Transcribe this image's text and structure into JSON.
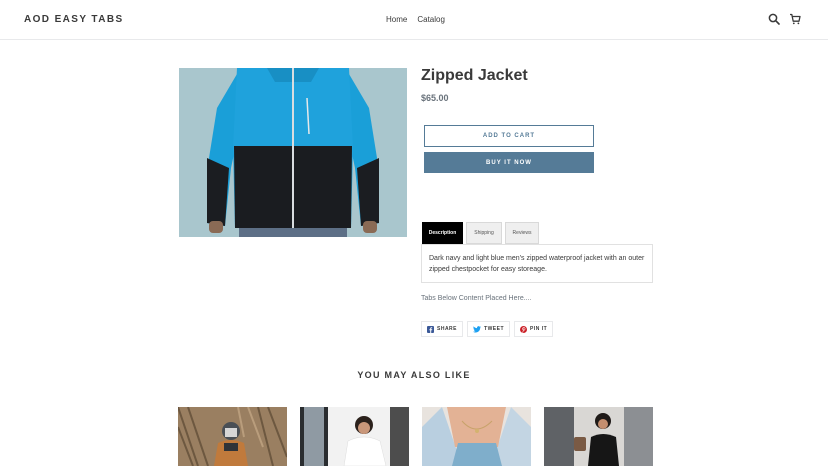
{
  "header": {
    "logo": "AOD EASY TABS",
    "nav": [
      "Home",
      "Catalog"
    ],
    "icons": [
      "search-icon",
      "cart-icon"
    ]
  },
  "product": {
    "title": "Zipped Jacket",
    "price": "$65.00",
    "add_to_cart": "ADD TO CART",
    "buy_now": "BUY IT NOW",
    "tabs": [
      "Description",
      "Shipping",
      "Reviews"
    ],
    "active_tab": "Description",
    "description": "Dark navy and light blue men's zipped waterproof jacket with an outer zipped chestpocket for easy storeage.",
    "below_text": "Tabs Below Content Placed Here...."
  },
  "share": {
    "facebook": "SHARE",
    "twitter": "TWEET",
    "pinterest": "PIN IT"
  },
  "related": {
    "title": "YOU MAY ALSO LIKE"
  },
  "colors": {
    "accent": "#557b97",
    "tab_active": "#000000",
    "jacket_blue": "#1fa2dc",
    "jacket_black": "#1a1c20"
  }
}
